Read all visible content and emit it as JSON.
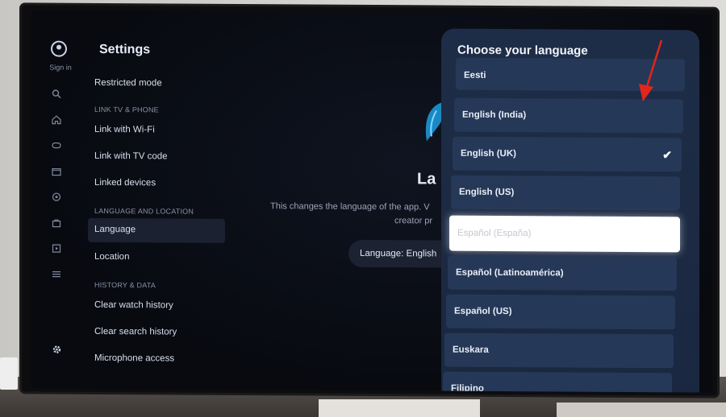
{
  "sidebar": {
    "signin_label": "Sign in",
    "icons": [
      "search-icon",
      "home-icon",
      "gaming-icon",
      "movies-icon",
      "music-icon",
      "shopping-icon",
      "library-icon",
      "menu-icon",
      "settings-icon"
    ]
  },
  "settings": {
    "title": "Settings",
    "items": [
      {
        "type": "item",
        "label": "Restricted mode"
      },
      {
        "type": "header",
        "label": "LINK TV & PHONE"
      },
      {
        "type": "item",
        "label": "Link with Wi-Fi"
      },
      {
        "type": "item",
        "label": "Link with TV code"
      },
      {
        "type": "item",
        "label": "Linked devices"
      },
      {
        "type": "header",
        "label": "LANGUAGE AND LOCATION"
      },
      {
        "type": "item",
        "label": "Language",
        "selected": true
      },
      {
        "type": "item",
        "label": "Location"
      },
      {
        "type": "header",
        "label": "HISTORY & DATA"
      },
      {
        "type": "item",
        "label": "Clear watch history"
      },
      {
        "type": "item",
        "label": "Clear search history"
      },
      {
        "type": "item",
        "label": "Microphone access"
      }
    ]
  },
  "content": {
    "title": "La",
    "description_line1": "This changes the language of the app. V",
    "description_line2": "creator pr",
    "language_button": "Language: English"
  },
  "language_panel": {
    "title": "Choose your language",
    "options": [
      {
        "label": "Eesti",
        "state": "normal"
      },
      {
        "label": "English (India)",
        "state": "normal"
      },
      {
        "label": "English (UK)",
        "state": "checked"
      },
      {
        "label": "English (US)",
        "state": "normal"
      },
      {
        "label": "Español (España)",
        "state": "focused"
      },
      {
        "label": "Español (Latinoamérica)",
        "state": "normal"
      },
      {
        "label": "Español (US)",
        "state": "normal"
      },
      {
        "label": "Euskara",
        "state": "normal"
      },
      {
        "label": "Filipino",
        "state": "normal"
      }
    ],
    "check_icon": "checkmark-icon"
  },
  "colors": {
    "panel_bg": "#1e2d47",
    "option_bg": "#263857",
    "focus_bg": "#ffffff",
    "annotation_arrow": "#e0261d"
  }
}
